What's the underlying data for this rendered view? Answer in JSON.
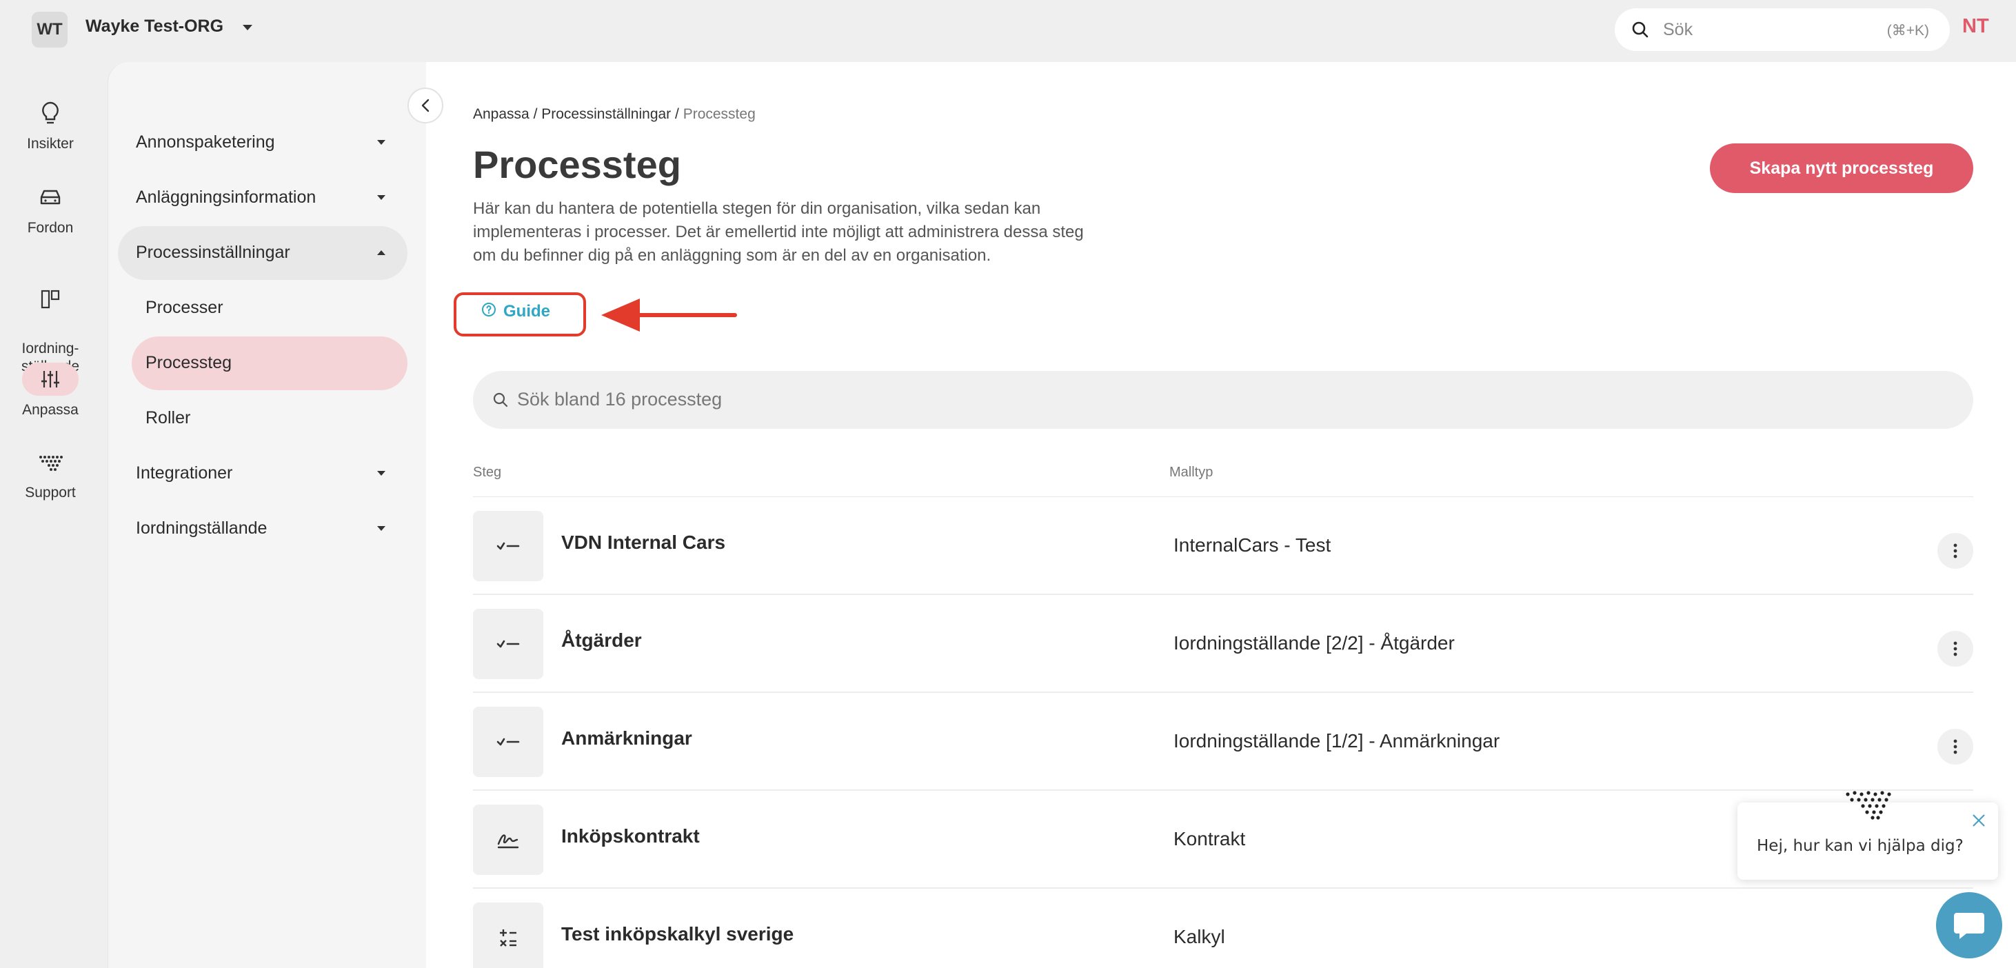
{
  "topbar": {
    "org_initials": "WT",
    "org_name": "Wayke Test-ORG",
    "search_placeholder": "Sök",
    "search_shortcut": "(⌘+K)",
    "user_initials": "NT"
  },
  "rail": {
    "items": [
      {
        "label": "Insikter",
        "icon": "lightbulb-icon"
      },
      {
        "label": "Fordon",
        "icon": "car-icon"
      },
      {
        "label": "Iordning-\nställande",
        "icon": "board-icon"
      },
      {
        "label": "Anpassa",
        "icon": "sliders-icon",
        "active": true
      },
      {
        "label": "Support",
        "icon": "support-icon"
      }
    ]
  },
  "nav": {
    "items": [
      {
        "label": "Annonspaketering"
      },
      {
        "label": "Anläggningsinformation"
      },
      {
        "label": "Processinställningar",
        "open": true
      },
      {
        "label": "Integrationer"
      },
      {
        "label": "Iordningställande"
      }
    ],
    "sub_items": [
      {
        "label": "Processer"
      },
      {
        "label": "Processteg",
        "active": true
      },
      {
        "label": "Roller"
      }
    ]
  },
  "main": {
    "breadcrumb": {
      "part1": "Anpassa",
      "sep": " / ",
      "part2": "Processinställningar",
      "current": "Processteg"
    },
    "title": "Processteg",
    "description": "Här kan du hantera de potentiella stegen för din organisation, vilka sedan kan implementeras i processer. Det är emellertid inte möjligt att administrera dessa steg om du befinner dig på en anläggning som är en del av en organisation.",
    "guide_label": "Guide",
    "create_button": "Skapa nytt processteg",
    "list_search_placeholder": "Sök bland 16 processteg",
    "columns": {
      "step": "Steg",
      "template": "Malltyp"
    },
    "rows": [
      {
        "name": "VDN Internal Cars",
        "type": "InternalCars - Test",
        "icon": "checklist-icon"
      },
      {
        "name": "Åtgärder",
        "type": "Iordningställande [2/2] - Åtgärder",
        "icon": "checklist-icon"
      },
      {
        "name": "Anmärkningar",
        "type": "Iordningställande [1/2] - Anmärkningar",
        "icon": "checklist-icon"
      },
      {
        "name": "Inköpskontrakt",
        "type": "Kontrakt",
        "icon": "signature-icon"
      },
      {
        "name": "Test inköpskalkyl sverige",
        "type": "Kalkyl",
        "icon": "calculator-icon"
      }
    ]
  },
  "chat": {
    "message": "Hej, hur kan vi hjälpa dig?"
  },
  "colors": {
    "accent": "#e05a6a",
    "accent_soft": "#f5d4d7",
    "link": "#2ea7c6",
    "annotation": "#e23b2b",
    "chat": "#4a9fc2"
  }
}
